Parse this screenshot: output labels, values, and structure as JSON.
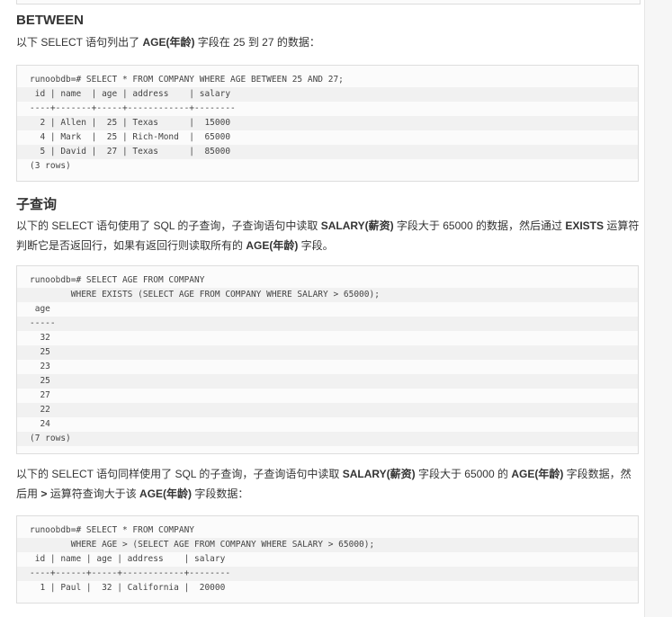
{
  "between": {
    "heading": "BETWEEN",
    "intro": [
      {
        "text": "以下 SELECT 语句列出了 "
      },
      {
        "text": "AGE(年龄)",
        "bold": true
      },
      {
        "text": " 字段在 25 到 27 的数据："
      }
    ],
    "code": [
      "runoobdb=# SELECT * FROM COMPANY WHERE AGE BETWEEN 25 AND 27;",
      " id | name  | age | address    | salary",
      "----+-------+-----+------------+--------",
      "  2 | Allen |  25 | Texas      |  15000",
      "  4 | Mark  |  25 | Rich-Mond  |  65000",
      "  5 | David |  27 | Texas      |  85000",
      "(3 rows)"
    ]
  },
  "subquery": {
    "heading": "子查询",
    "intro": [
      {
        "text": "以下的 SELECT 语句使用了 SQL 的子查询，子查询语句中读取 "
      },
      {
        "text": "SALARY(薪资)",
        "bold": true
      },
      {
        "text": " 字段大于 65000 的数据，然后通过 "
      },
      {
        "text": "EXISTS",
        "bold": true
      },
      {
        "text": " 运算符判断它是否返回行，如果有返回行则读取所有的 "
      },
      {
        "text": "AGE(年龄)",
        "bold": true
      },
      {
        "text": " 字段。"
      }
    ],
    "code": [
      "runoobdb=# SELECT AGE FROM COMPANY",
      "        WHERE EXISTS (SELECT AGE FROM COMPANY WHERE SALARY > 65000);",
      " age",
      "-----",
      "  32",
      "  25",
      "  23",
      "  25",
      "  27",
      "  22",
      "  24",
      "(7 rows)"
    ],
    "intro2": [
      {
        "text": "以下的 SELECT 语句同样使用了 SQL 的子查询，子查询语句中读取 "
      },
      {
        "text": "SALARY(薪资)",
        "bold": true
      },
      {
        "text": " 字段大于 65000 的 "
      },
      {
        "text": "AGE(年龄)",
        "bold": true
      },
      {
        "text": " 字段数据，然后用 "
      },
      {
        "text": ">",
        "bold": true
      },
      {
        "text": " 运算符查询大于该 "
      },
      {
        "text": "AGE(年龄)",
        "bold": true
      },
      {
        "text": " 字段数据："
      }
    ],
    "code2": [
      "runoobdb=# SELECT * FROM COMPANY",
      "        WHERE AGE > (SELECT AGE FROM COMPANY WHERE SALARY > 65000);",
      " id | name | age | address    | salary",
      "----+------+-----+------------+--------",
      "  1 | Paul |  32 | California |  20000"
    ]
  }
}
